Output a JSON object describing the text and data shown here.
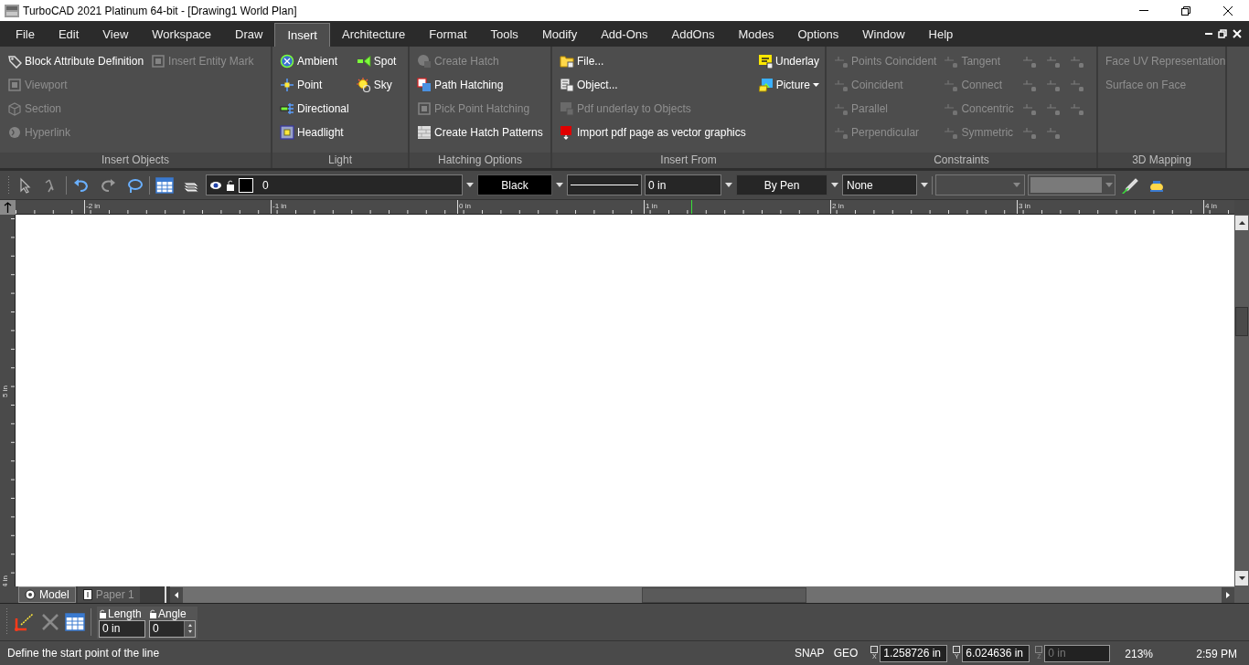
{
  "window": {
    "title": "TurboCAD 2021 Platinum 64-bit - [Drawing1 World Plan]"
  },
  "menu": [
    {
      "label": "File",
      "selected": false
    },
    {
      "label": "Edit",
      "selected": false
    },
    {
      "label": "View",
      "selected": false
    },
    {
      "label": "Workspace",
      "selected": false
    },
    {
      "label": "Draw",
      "selected": false
    },
    {
      "label": "Insert",
      "selected": true
    },
    {
      "label": "Architecture",
      "selected": false
    },
    {
      "label": "Format",
      "selected": false
    },
    {
      "label": "Tools",
      "selected": false
    },
    {
      "label": "Modify",
      "selected": false
    },
    {
      "label": "Add-Ons",
      "selected": false
    },
    {
      "label": "AddOns",
      "selected": false
    },
    {
      "label": "Modes",
      "selected": false
    },
    {
      "label": "Options",
      "selected": false
    },
    {
      "label": "Window",
      "selected": false
    },
    {
      "label": "Help",
      "selected": false
    }
  ],
  "ribbon": {
    "groups": [
      {
        "title": "Insert Objects",
        "columns": [
          [
            {
              "label": "Block Attribute Definition",
              "disabled": false
            },
            {
              "label": "Viewport",
              "disabled": true
            },
            {
              "label": "Section",
              "disabled": true
            },
            {
              "label": "Hyperlink",
              "disabled": true
            }
          ],
          [
            {
              "label": "Insert Entity Mark",
              "disabled": true
            }
          ]
        ]
      },
      {
        "title": "Light",
        "columns": [
          [
            {
              "label": "Ambient",
              "disabled": false
            },
            {
              "label": "Point",
              "disabled": false
            },
            {
              "label": "Directional",
              "disabled": false
            },
            {
              "label": "Headlight",
              "disabled": false
            }
          ],
          [
            {
              "label": "Spot",
              "disabled": false
            },
            {
              "label": "Sky",
              "disabled": false
            }
          ]
        ]
      },
      {
        "title": "Hatching Options",
        "columns": [
          [
            {
              "label": "Create Hatch",
              "disabled": true
            },
            {
              "label": "Path Hatching",
              "disabled": false
            },
            {
              "label": "Pick Point Hatching",
              "disabled": true
            },
            {
              "label": "Create Hatch Patterns",
              "disabled": false
            }
          ]
        ]
      },
      {
        "title": "Insert From",
        "columns": [
          [
            {
              "label": "File...",
              "disabled": false
            },
            {
              "label": "Object...",
              "disabled": false
            },
            {
              "label": "Pdf underlay to Objects",
              "disabled": true
            },
            {
              "label": "Import pdf page as vector graphics",
              "disabled": false
            }
          ],
          [
            {
              "label": "Underlay",
              "disabled": false
            },
            {
              "label": "Picture",
              "disabled": false,
              "dropdown": true
            }
          ]
        ]
      },
      {
        "title": "Constraints",
        "columns": [
          [
            {
              "label": "Points Coincident",
              "disabled": true
            },
            {
              "label": "Coincident",
              "disabled": true
            },
            {
              "label": "Parallel",
              "disabled": true
            },
            {
              "label": "Perpendicular",
              "disabled": true
            }
          ],
          [
            {
              "label": "Tangent",
              "disabled": true
            },
            {
              "label": "Connect",
              "disabled": true
            },
            {
              "label": "Concentric",
              "disabled": true
            },
            {
              "label": "Symmetric",
              "disabled": true
            }
          ]
        ]
      },
      {
        "title": "3D Mapping",
        "columns": [
          [
            {
              "label": "Face UV Representation",
              "disabled": true
            },
            {
              "label": "Surface on Face",
              "disabled": true
            }
          ]
        ]
      }
    ]
  },
  "toolbar": {
    "layer": "0",
    "color_name": "Black",
    "line_width": "0 in",
    "pen": "By Pen",
    "fill": "None"
  },
  "ruler": {
    "horizontal_labels": [
      "-2 in",
      "-1 in",
      "0 in",
      "1 in",
      "2 in",
      "3 in",
      "4 in"
    ],
    "vertical_labels": [
      "5 in",
      "4 in"
    ]
  },
  "sheet_tabs": [
    {
      "label": "Model",
      "selected": true
    },
    {
      "label": "Paper 1",
      "selected": false
    }
  ],
  "inspector": {
    "length_label": "Length",
    "length_value": "0 in",
    "angle_label": "Angle",
    "angle_value": "0"
  },
  "status_bar": {
    "message": "Define the start point of the line",
    "snap": "SNAP",
    "geo": "GEO",
    "coordinates": [
      {
        "axis": "X",
        "value": "1.258726 in",
        "disabled": false
      },
      {
        "axis": "Y",
        "value": "6.024636 in",
        "disabled": false
      },
      {
        "axis": "Z",
        "value": "0 in",
        "disabled": true
      }
    ],
    "zoom": "213%",
    "time": "2:59 PM"
  }
}
